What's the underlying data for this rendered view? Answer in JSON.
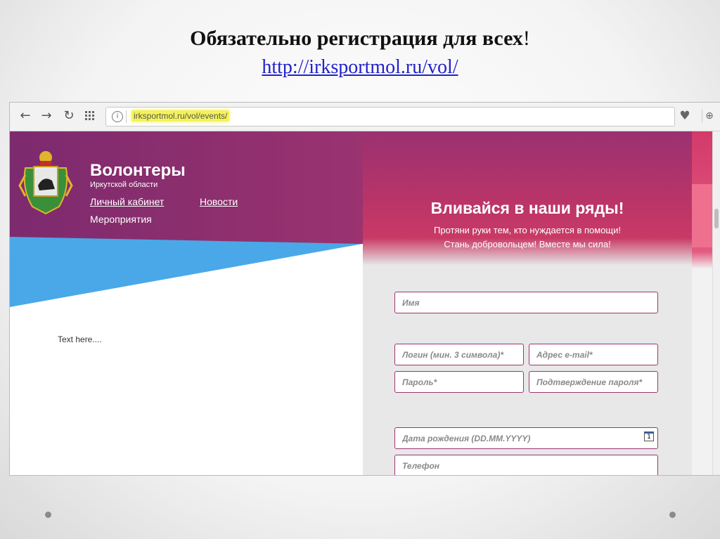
{
  "slide": {
    "title_bold": "Обязательно регистрация для всех",
    "title_rest": "!",
    "link": "http://irksportmol.ru/vol/"
  },
  "browser": {
    "url": "irksportmol.ru/vol/events/",
    "icons": [
      "back-icon",
      "forward-icon",
      "reload-icon",
      "apps-grid-icon",
      "info-icon",
      "heart-icon",
      "download-icon"
    ]
  },
  "site": {
    "title": "Волонтеры",
    "subtitle": "Иркутской области",
    "nav": [
      "Личный кабинет",
      "Новости",
      "Мероприятия"
    ],
    "body_text": "Text here...."
  },
  "form": {
    "heading": "Вливайся в наши ряды!",
    "subline1": "Протяни руки тем, кто нуждается в помощи!",
    "subline2": "Стань добровольцем! Вместе мы сила!",
    "placeholders": {
      "name": "Имя",
      "login": "Логин (мин. 3 символа)*",
      "email": "Адрес e-mail*",
      "password": "Пароль*",
      "password_confirm": "Подтверждение пароля*",
      "birthdate": "Дата рождения (DD.MM.YYYY)",
      "phone": "Телефон"
    },
    "calendar_day": "1"
  },
  "colors": {
    "brand_purple": "#8e2f6e",
    "brand_pink": "#c93a66",
    "field_border": "#9b3672",
    "blue_accent": "#4aa8e8",
    "url_highlight": "#f4f25a",
    "link_blue": "#2222cc"
  }
}
